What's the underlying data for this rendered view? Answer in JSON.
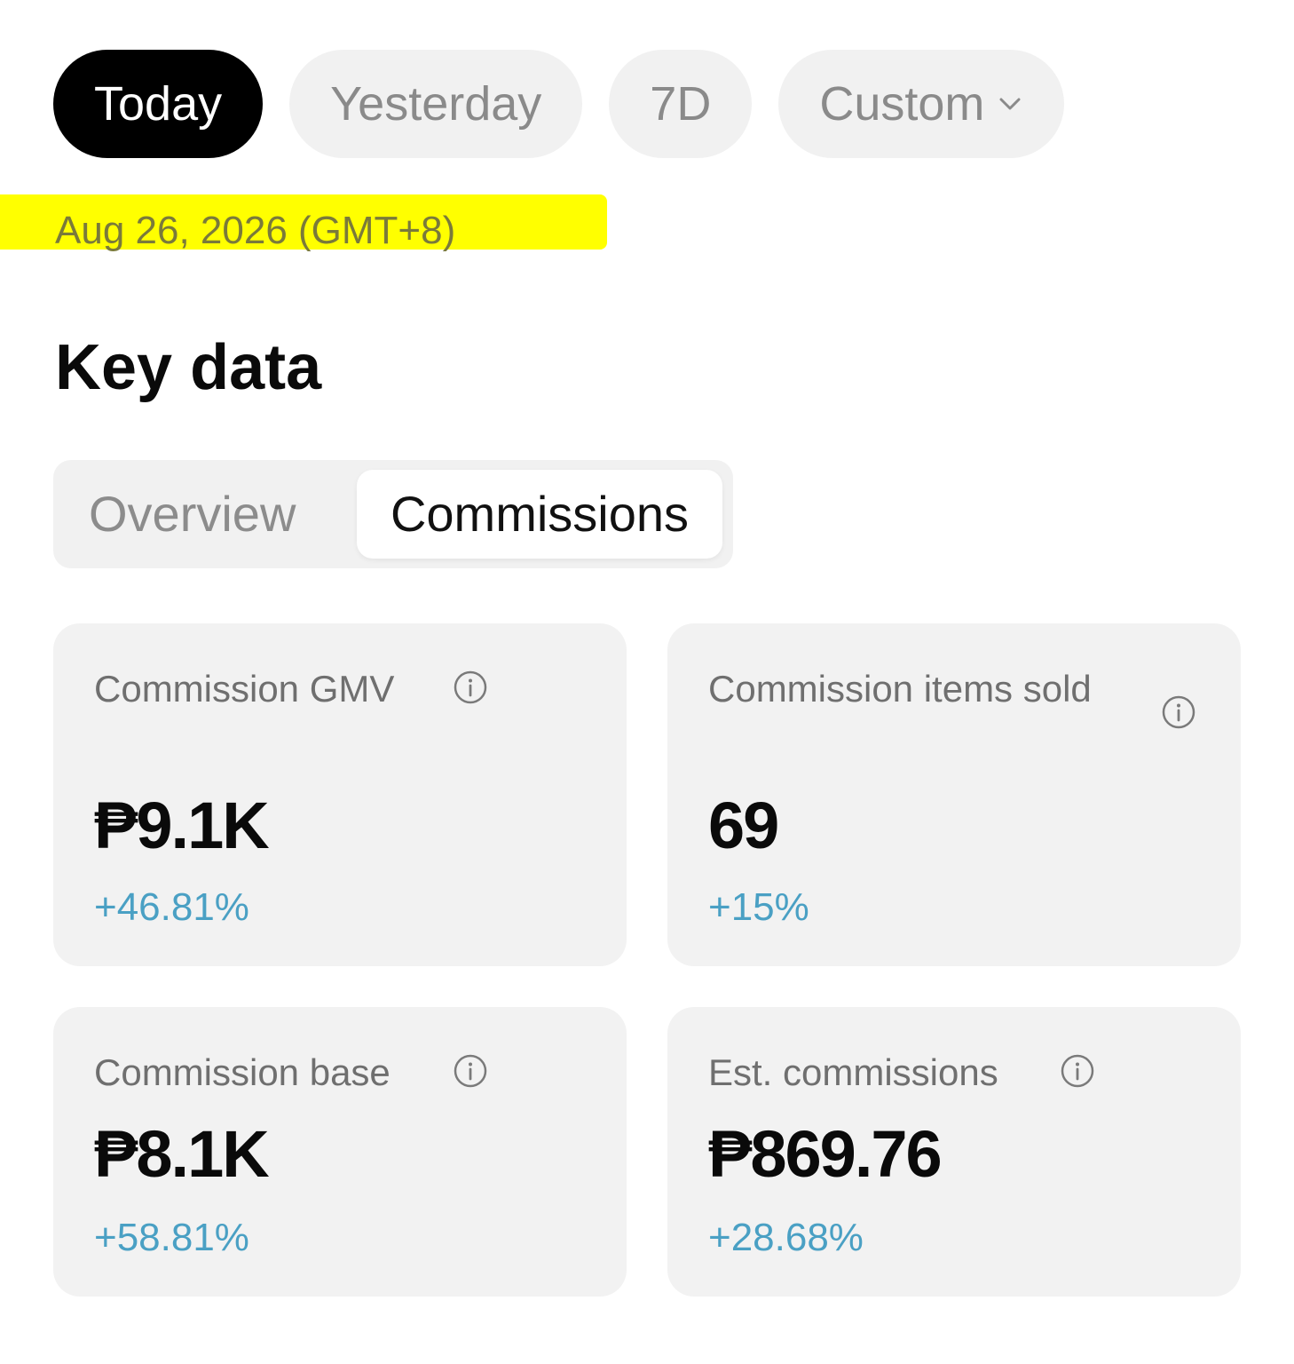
{
  "date_filters": [
    {
      "label": "Today",
      "active": true
    },
    {
      "label": "Yesterday",
      "active": false
    },
    {
      "label": "7D",
      "active": false
    },
    {
      "label": "Custom",
      "active": false,
      "icon": "chevron-down-icon"
    }
  ],
  "date_range": "Aug 26, 2026 (GMT+8)",
  "highlight_color": "#ffff00",
  "section_title": "Key data",
  "tabs": [
    {
      "label": "Overview",
      "active": false
    },
    {
      "label": "Commissions",
      "active": true
    }
  ],
  "metrics": [
    {
      "label": "Commission GMV",
      "value": "₱9.1K",
      "change": "+46.81%",
      "icon": "info-icon"
    },
    {
      "label": "Commission items sold",
      "value": "69",
      "change": "+15%",
      "icon": "info-icon"
    },
    {
      "label": "Commission base",
      "value": "₱8.1K",
      "change": "+58.81%",
      "icon": "info-icon"
    },
    {
      "label": "Est. commissions",
      "value": "₱869.76",
      "change": "+28.68%",
      "icon": "info-icon"
    }
  ],
  "colors": {
    "active_pill": "#000000",
    "inactive_pill": "#f1f1f1",
    "card_bg": "#f2f2f2",
    "change_positive": "#4aa0c4"
  }
}
